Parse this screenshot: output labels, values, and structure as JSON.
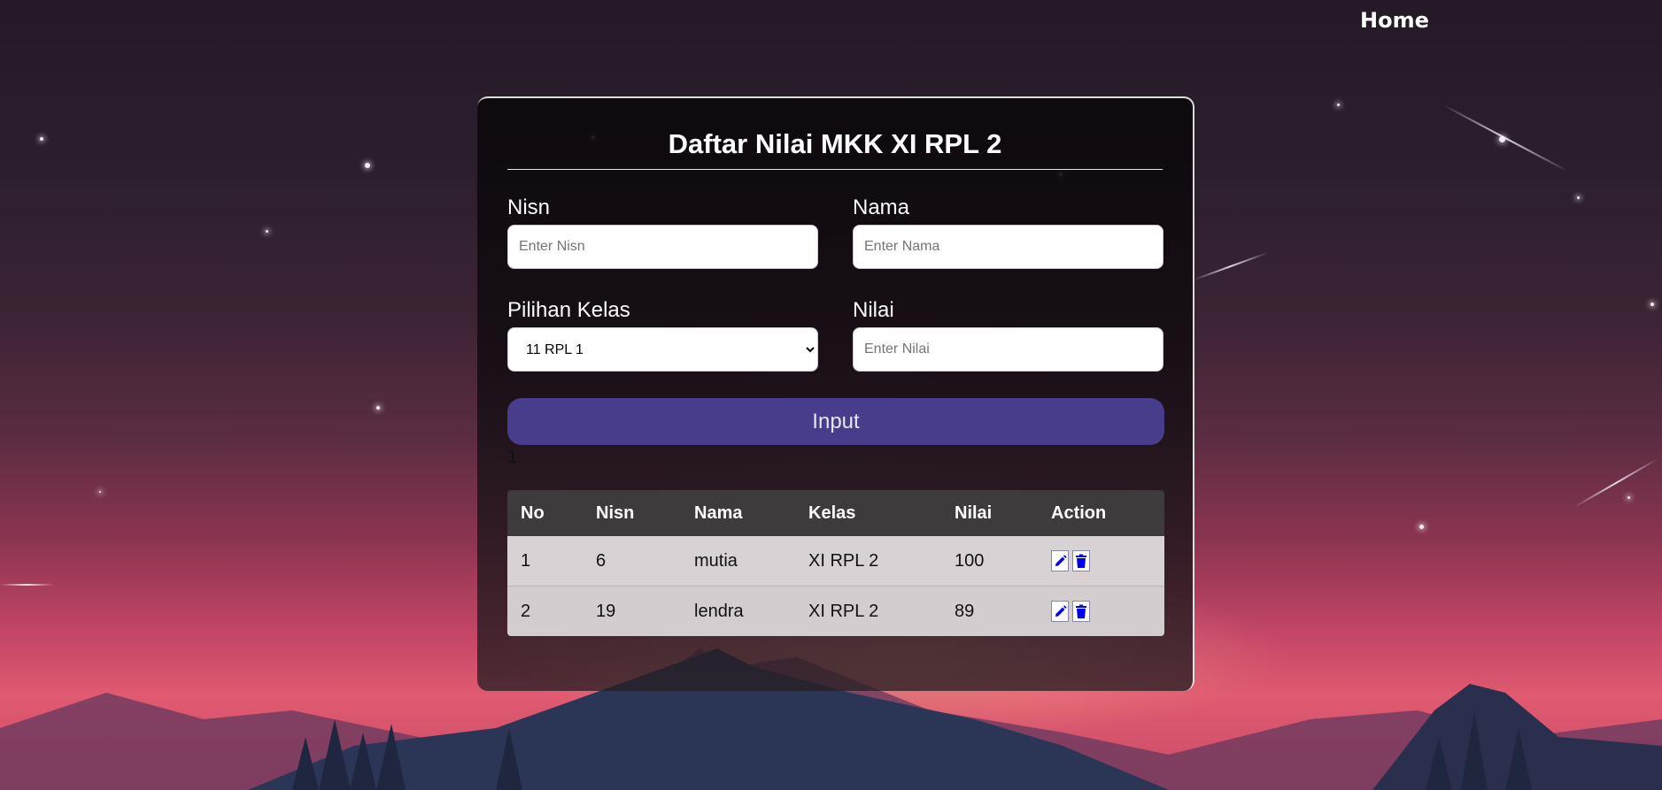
{
  "nav": {
    "home_label": "Home"
  },
  "form": {
    "title": "Daftar Nilai MKK XI RPL 2",
    "nisn": {
      "label": "Nisn",
      "placeholder": "Enter Nisn",
      "value": ""
    },
    "nama": {
      "label": "Nama",
      "placeholder": "Enter Nama",
      "value": ""
    },
    "kelas": {
      "label": "Pilihan Kelas",
      "selected": "11 RPL 1"
    },
    "nilai": {
      "label": "Nilai",
      "placeholder": "Enter Nilai",
      "value": ""
    },
    "submit_label": "Input",
    "counter": "1"
  },
  "table": {
    "headers": [
      "No",
      "Nisn",
      "Nama",
      "Kelas",
      "Nilai",
      "Action"
    ],
    "rows": [
      {
        "no": "1",
        "nisn": "6",
        "nama": "mutia",
        "kelas": "XI RPL 2",
        "nilai": "100"
      },
      {
        "no": "2",
        "nisn": "19",
        "nama": "lendra",
        "kelas": "XI RPL 2",
        "nilai": "89"
      }
    ],
    "action_icons": [
      "edit-icon",
      "trash-icon"
    ]
  },
  "colors": {
    "button_bg": "#483d8b",
    "header_bg": "#3d3b3c",
    "icon_blue": "#0000ee"
  }
}
